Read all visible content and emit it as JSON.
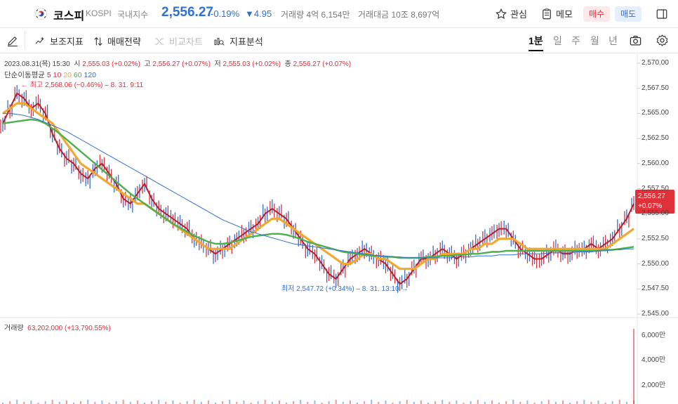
{
  "header": {
    "name": "코스피",
    "code": "KOSPI",
    "category": "국내지수",
    "price": "2,556.27",
    "change_pct": "-0.19%",
    "change_abs": "▼4.95",
    "volume": "거래량 4억 6,154만",
    "amount": "거래대금 10조 8,697억",
    "watch_label": "관심",
    "memo_label": "메모",
    "buy_label": "매수",
    "sell_label": "매도"
  },
  "toolbar": {
    "aux_label": "보조지표",
    "strategy_label": "매매전략",
    "compare_label": "비교차트",
    "analysis_label": "지표분석",
    "periods": [
      "1분",
      "일",
      "주",
      "월",
      "년"
    ],
    "active_period": "1분"
  },
  "info": {
    "date": "2023.08.31(목) 15:30",
    "open_label": "시",
    "open": "2,555.03 (+0.02%)",
    "high_label": "고",
    "high": "2,556.27 (+0.07%)",
    "low_label": "저",
    "low": "2,555.03 (+0.02%)",
    "close_label": "종",
    "close": "2,556.27 (+0.07%)"
  },
  "ma": {
    "label": "단순이동평균",
    "periods": [
      "5",
      "10",
      "20",
      "60",
      "120"
    ],
    "colors": [
      "#b81f2b",
      "#e0303a",
      "#f0a830",
      "#4caf50",
      "#2f6fd6"
    ]
  },
  "annotations": {
    "high": "← 최고 2,568.06 (−0.46%) – 8. 31. 9:11",
    "low": "최저 2,547.72 (+0.34%) – 8. 31. 13:10 →"
  },
  "volume_info": {
    "label": "거래량",
    "value": "63,202,000 (+13,790.55%)"
  },
  "price_tag": {
    "price": "2,556.27",
    "pct": "+0.07%"
  },
  "y_axis": [
    "2,570.00",
    "2,567.50",
    "2,565.00",
    "2,562.50",
    "2,560.00",
    "2,557.50",
    "2,555.00",
    "2,552.50",
    "2,550.00",
    "2,547.50",
    "2,545.00"
  ],
  "vol_axis": [
    "6,000만",
    "4,000만",
    "2,000만"
  ],
  "colors": {
    "up": "#e0303a",
    "down": "#2f6fd6",
    "accent": "#2f6fd6"
  },
  "chart_data": {
    "type": "line",
    "title": "",
    "x": [
      1,
      2,
      3,
      4,
      5,
      6,
      7,
      8,
      9,
      10,
      11,
      12,
      13,
      14,
      15,
      16,
      17,
      18,
      19,
      20,
      21,
      22,
      23,
      24,
      25,
      26,
      27,
      28,
      29,
      30,
      31,
      32,
      33,
      34,
      35,
      36,
      37,
      38,
      39,
      40,
      41,
      42,
      43,
      44,
      45,
      46,
      47,
      48,
      49,
      50,
      51,
      52,
      53,
      54,
      55,
      56,
      57,
      58,
      59,
      60,
      61,
      62,
      63,
      64,
      65,
      66,
      67,
      68,
      69,
      70,
      71,
      72,
      73,
      74,
      75,
      76,
      77,
      78,
      79,
      80,
      81,
      82,
      83,
      84,
      85,
      86,
      87,
      88,
      89,
      90
    ],
    "series": [
      {
        "name": "5",
        "values": [
          2564.0,
          2565.5,
          2567.0,
          2566.5,
          2565.5,
          2566.0,
          2565.0,
          2563.0,
          2561.5,
          2560.5,
          2560.0,
          2559.0,
          2558.5,
          2559.5,
          2560.0,
          2559.0,
          2558.0,
          2556.5,
          2556.0,
          2557.0,
          2558.0,
          2556.5,
          2555.5,
          2555.0,
          2554.5,
          2554.0,
          2553.5,
          2552.5,
          2552.0,
          2551.5,
          2551.0,
          2551.5,
          2552.0,
          2552.5,
          2553.0,
          2553.5,
          2554.0,
          2555.0,
          2555.5,
          2555.0,
          2554.5,
          2553.5,
          2552.5,
          2551.5,
          2551.0,
          2550.0,
          2549.0,
          2548.5,
          2549.5,
          2550.5,
          2551.0,
          2551.5,
          2551.0,
          2550.5,
          2550.0,
          2549.0,
          2548.0,
          2548.5,
          2549.5,
          2550.5,
          2550.5,
          2551.0,
          2551.5,
          2551.0,
          2550.5,
          2551.0,
          2551.5,
          2552.0,
          2552.5,
          2553.0,
          2553.5,
          2553.5,
          2552.5,
          2551.5,
          2551.0,
          2550.5,
          2550.5,
          2551.0,
          2551.5,
          2551.0,
          2551.0,
          2551.5,
          2551.5,
          2552.0,
          2551.5,
          2552.0,
          2552.5,
          2553.5,
          2554.5,
          2556.0
        ]
      },
      {
        "name": "20",
        "values": [
          2565.0,
          2565.5,
          2566.0,
          2566.0,
          2565.5,
          2565.0,
          2564.5,
          2564.0,
          2563.0,
          2562.0,
          2561.0,
          2560.0,
          2559.5,
          2559.0,
          2558.5,
          2558.0,
          2557.5,
          2557.0,
          2556.5,
          2556.0,
          2556.0,
          2555.5,
          2555.0,
          2554.5,
          2554.0,
          2553.5,
          2553.0,
          2552.5,
          2552.0,
          2551.5,
          2551.5,
          2551.5,
          2551.5,
          2552.0,
          2552.5,
          2553.0,
          2553.5,
          2554.0,
          2554.5,
          2554.5,
          2554.0,
          2553.5,
          2553.0,
          2552.5,
          2552.0,
          2551.5,
          2551.0,
          2550.5,
          2550.0,
          2550.0,
          2550.5,
          2551.0,
          2551.0,
          2550.5,
          2550.5,
          2550.0,
          2549.5,
          2549.5,
          2549.5,
          2550.0,
          2550.5,
          2550.5,
          2551.0,
          2551.0,
          2551.0,
          2551.0,
          2551.5,
          2551.5,
          2552.0,
          2552.0,
          2552.5,
          2552.5,
          2552.5,
          2552.0,
          2551.5,
          2551.5,
          2551.5,
          2551.5,
          2551.5,
          2551.5,
          2551.5,
          2551.5,
          2551.5,
          2551.5,
          2551.5,
          2551.5,
          2552.0,
          2552.5,
          2553.0,
          2553.5
        ]
      },
      {
        "name": "60",
        "values": [
          2564.0,
          2564.1,
          2564.2,
          2564.3,
          2564.4,
          2564.3,
          2564.0,
          2563.5,
          2563.0,
          2562.4,
          2561.8,
          2561.2,
          2560.6,
          2560.0,
          2559.4,
          2558.8,
          2558.2,
          2557.6,
          2557.0,
          2556.5,
          2556.0,
          2555.5,
          2555.0,
          2554.5,
          2554.0,
          2553.6,
          2553.2,
          2552.8,
          2552.5,
          2552.2,
          2552.0,
          2552.0,
          2552.1,
          2552.3,
          2552.5,
          2552.7,
          2552.8,
          2552.9,
          2553.0,
          2553.0,
          2552.9,
          2552.7,
          2552.5,
          2552.2,
          2552.0,
          2551.8,
          2551.6,
          2551.4,
          2551.2,
          2551.1,
          2551.0,
          2550.9,
          2550.8,
          2550.8,
          2550.7,
          2550.7,
          2550.6,
          2550.6,
          2550.6,
          2550.6,
          2550.7,
          2550.7,
          2550.8,
          2550.8,
          2550.9,
          2550.9,
          2551.0,
          2551.0,
          2551.1,
          2551.2,
          2551.2,
          2551.3,
          2551.3,
          2551.3,
          2551.3,
          2551.3,
          2551.3,
          2551.3,
          2551.3,
          2551.3,
          2551.3,
          2551.3,
          2551.3,
          2551.3,
          2551.3,
          2551.4,
          2551.4,
          2551.5,
          2551.6,
          2551.7
        ]
      },
      {
        "name": "120",
        "values": [
          2565.0,
          2565.0,
          2564.9,
          2564.8,
          2564.6,
          2564.4,
          2564.1,
          2563.8,
          2563.5,
          2563.2,
          2562.8,
          2562.4,
          2562.0,
          2561.6,
          2561.2,
          2560.8,
          2560.4,
          2560.0,
          2559.6,
          2559.2,
          2558.8,
          2558.4,
          2558.0,
          2557.6,
          2557.2,
          2556.8,
          2556.4,
          2556.0,
          2555.6,
          2555.2,
          2554.8,
          2554.4,
          2554.1,
          2553.8,
          2553.5,
          2553.2,
          2553.0,
          2552.8,
          2552.6,
          2552.4,
          2552.2,
          2552.0,
          2551.9,
          2551.8,
          2551.7,
          2551.6,
          2551.5,
          2551.4,
          2551.3,
          2551.2,
          2551.1,
          2551.0,
          2550.9,
          2550.8,
          2550.8,
          2550.7,
          2550.7,
          2550.6,
          2550.6,
          2550.6,
          2550.6,
          2550.6,
          2550.6,
          2550.6,
          2550.7,
          2550.7,
          2550.7,
          2550.8,
          2550.8,
          2550.8,
          2550.9,
          2550.9,
          2550.9,
          2551.0,
          2551.0,
          2551.0,
          2551.0,
          2551.1,
          2551.1,
          2551.1,
          2551.1,
          2551.2,
          2551.2,
          2551.2,
          2551.3,
          2551.3,
          2551.4,
          2551.4,
          2551.5,
          2551.5
        ]
      }
    ],
    "ylim": [
      2545,
      2570
    ],
    "high": {
      "value": 2568.06,
      "time": "8. 31. 9:11"
    },
    "low": {
      "value": 2547.72,
      "time": "8. 31. 13:10"
    },
    "volume_max": 6320.2
  }
}
